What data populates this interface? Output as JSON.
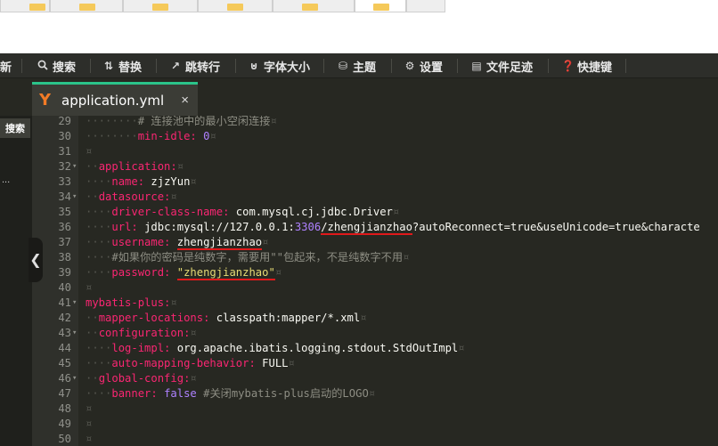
{
  "toolbar": {
    "items": [
      {
        "label": "新",
        "icon": ""
      },
      {
        "label": "搜索",
        "icon": "search-icon"
      },
      {
        "label": "替换",
        "icon": "replace-icon"
      },
      {
        "label": "跳转行",
        "icon": "goto-line-icon"
      },
      {
        "label": "字体大小",
        "icon": "font-size-icon"
      },
      {
        "label": "主题",
        "icon": "theme-icon"
      },
      {
        "label": "设置",
        "icon": "gear-icon"
      },
      {
        "label": "文件足迹",
        "icon": "history-icon"
      },
      {
        "label": "快捷键",
        "icon": "help-icon"
      }
    ]
  },
  "file_tab": {
    "name": "application.yml",
    "close": "×",
    "logo": "Y"
  },
  "left_panel": {
    "search_tab": "搜索",
    "dots": "..."
  },
  "colors": {
    "tab_accent": "#2bc48a",
    "yaml_logo": "#f27b26",
    "underline": "#e0191b"
  },
  "editor": {
    "line_numbers": [
      "29",
      "30",
      "31",
      "32",
      "33",
      "34",
      "35",
      "36",
      "37",
      "38",
      "39",
      "40",
      "41",
      "42",
      "43",
      "44",
      "45",
      "46",
      "47",
      "48",
      "49",
      "50"
    ],
    "fold_lines": [
      "32",
      "34",
      "41",
      "43",
      "46"
    ],
    "lines": {
      "l29_comment": "# 连接池中的最小空闲连接",
      "l30_key": "min-idle:",
      "l30_val": "0",
      "l32_key": "application:",
      "l33_key": "name:",
      "l33_val": "zjzYun",
      "l34_key": "datasource:",
      "l35_key": "driver-class-name:",
      "l35_val": "com.mysql.cj.jdbc.Driver",
      "l36_key": "url:",
      "l36_val_a": "jdbc:mysql://127.0.0.1:",
      "l36_port": "3306",
      "l36_db": "/zhengjianzhao",
      "l36_val_b": "?autoReconnect=true&useUnicode=true&characte",
      "l37_key": "username:",
      "l37_val": "zhengjianzhao",
      "l38_comment": "#如果你的密码是纯数字，需要用\"\"包起来，不是纯数字不用",
      "l39_key": "password:",
      "l39_val": "\"zhengjianzhao\"",
      "l41_key": "mybatis-plus:",
      "l42_key": "mapper-locations:",
      "l42_val": "classpath:mapper/*.xml",
      "l43_key": "configuration:",
      "l44_key": "log-impl:",
      "l44_val": "org.apache.ibatis.logging.stdout.StdOutImpl",
      "l45_key": "auto-mapping-behavior:",
      "l45_val": "FULL",
      "l46_key": "global-config:",
      "l47_key": "banner:",
      "l47_val": "false",
      "l47_comment": "#关闭mybatis-plus启动的LOGO"
    }
  }
}
